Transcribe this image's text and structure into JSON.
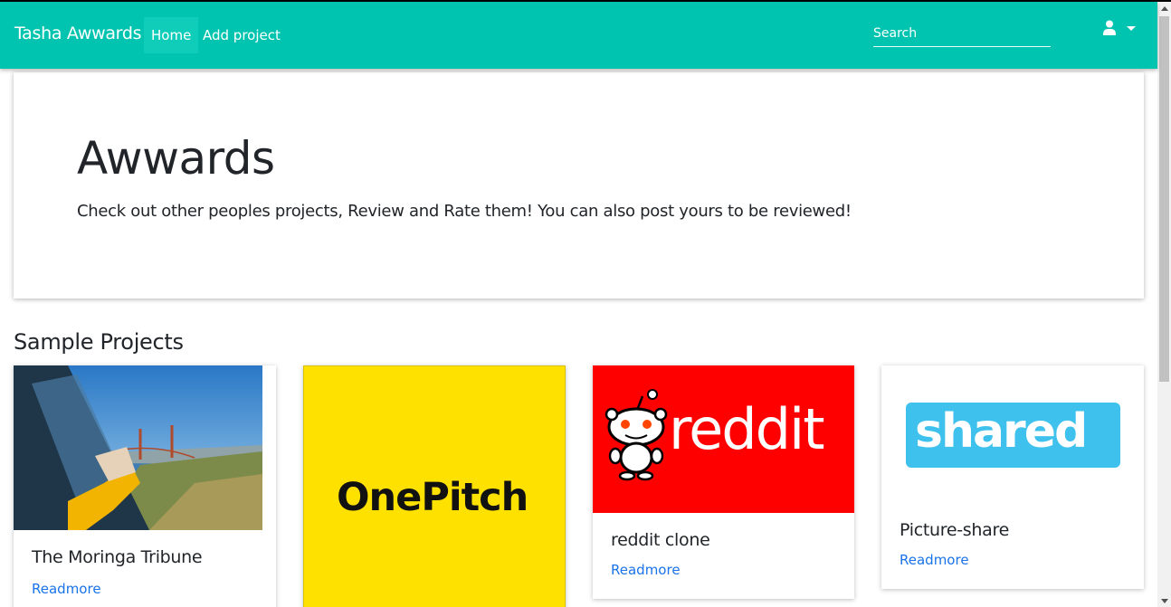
{
  "navbar": {
    "brand": "Tasha Awwards",
    "links": [
      {
        "label": "Home",
        "active": true
      },
      {
        "label": "Add project",
        "active": false
      }
    ],
    "search_placeholder": "Search",
    "user_icon": "user-icon",
    "accent_color": "#00c4b0"
  },
  "jumbotron": {
    "title": "Awwards",
    "text": "Check out other peoples projects, Review and Rate them! You can also post yours to be reviewed!"
  },
  "section": {
    "title": "Sample Projects"
  },
  "projects": [
    {
      "title": "The Moringa Tribune",
      "link": "Readmore",
      "image": "car-window-golden-gate-photo"
    },
    {
      "title": "",
      "link": "",
      "image": "onepitch-logo",
      "logo_text": "OnePitch"
    },
    {
      "title": "reddit clone",
      "link": "Readmore",
      "image": "reddit-logo",
      "logo_text": "reddit"
    },
    {
      "title": "Picture-share",
      "link": "Readmore",
      "image": "shared-logo",
      "logo_text": "shared"
    }
  ],
  "colors": {
    "link": "#1a73e8",
    "onepitch_bg": "#ffe100",
    "reddit_bg": "#ff0000",
    "shared_blue": "#3fc1ee"
  }
}
